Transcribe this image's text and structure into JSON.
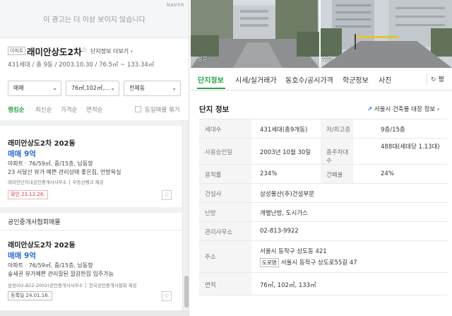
{
  "ad": {
    "text": "이 광고는 더 이상 보이지 않습니다",
    "brand": "NAVER"
  },
  "complex": {
    "type_badge": "아파트",
    "name": "래미안상도2차",
    "star_icon": "☆",
    "more_link": "단지정보 더보기 ›",
    "summary": "431세대 / 총 9동 / 2003.10.30 / 76.5㎡ ~ 133.34㎡"
  },
  "filters": {
    "trade": "매매",
    "area": "76㎡,102㎡,…",
    "dong": "전체동",
    "chevron": "⌄"
  },
  "sort": {
    "options": [
      "랭킹순",
      "최신순",
      "가격순",
      "면적순"
    ],
    "separator": "·",
    "same_listing_label": "동일매물 묶기"
  },
  "listings": [
    {
      "title": "래미안상도2차 202동",
      "price": "매매 9억",
      "spec": "아파트 · 76/59㎡, 중/15층, 남동향",
      "desc": "23 서달산 뷰가 예쁜 관리상태 좋은집, 안방욕실",
      "source": "래미안단지내공인중개사사무소 │ 부동산뱅크 제공",
      "confirm": "확인 23.12.26."
    },
    {
      "title": "래미안상도2차 202동",
      "price": "매매 9억",
      "spec": "아파트 · 76/59㎡, 중/15층, 남동향",
      "desc": "숲세권 뷰가예쁜 관리잘된 깔끔한집 입주가능",
      "source": "삼성(02-822-2002)공인중개사사무소 │ 한국공인중개사협회 제공",
      "confirm": "등록일 24.01.16."
    }
  ],
  "section_label": "공인중개사협회매물",
  "photo": {
    "label_left": "정문",
    "label_right": "후문"
  },
  "tabs": {
    "items": [
      "단지정보",
      "시세/실거래가",
      "동호수/공시가격",
      "학군정보",
      "사진"
    ],
    "refresh_icon": "↻",
    "floor_label": "평"
  },
  "info": {
    "title": "단지 정보",
    "link_icon": "↗",
    "link_label": "서울시 건축물 대장 정보 ›",
    "rows": [
      {
        "label": "세대수",
        "value": "431세대(총9개동)",
        "label2": "저/최고층",
        "value2": "9층/15층"
      },
      {
        "label": "사용승인일",
        "value": "2003년 10월 30일",
        "label2": "총주차대수",
        "value2": "488대(세대당 1.13대)"
      },
      {
        "label": "용적률",
        "value": "234%",
        "label2": "건폐율",
        "value2": "24%"
      },
      {
        "label": "건설사",
        "value": "삼성물산(주)건설부문"
      },
      {
        "label": "난방",
        "value": "개별난방, 도시가스"
      },
      {
        "label": "관리사무소",
        "value": "02-813-9922"
      },
      {
        "label": "주소",
        "value": "서울시 동작구 상도동 421",
        "road_badge": "도로명",
        "value_road": "서울시 동작구 상도로55길 47"
      },
      {
        "label": "면적",
        "value": "76㎡, 102㎡, 133㎡"
      }
    ]
  },
  "colors": {
    "accent_green": "#29a34a",
    "price_blue": "#2e6ad7",
    "confirm_red": "#e0364b"
  }
}
